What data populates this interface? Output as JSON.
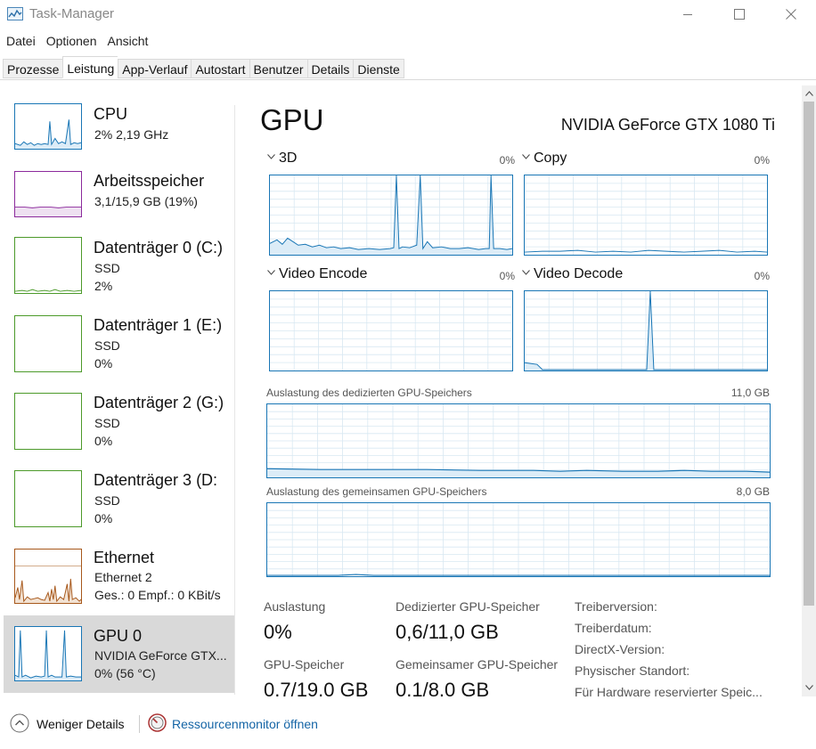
{
  "window": {
    "title": "Task-Manager"
  },
  "menu": [
    "Datei",
    "Optionen",
    "Ansicht"
  ],
  "tabs": [
    {
      "label": "Prozesse",
      "active": false
    },
    {
      "label": "Leistung",
      "active": true
    },
    {
      "label": "App-Verlauf",
      "active": false
    },
    {
      "label": "Autostart",
      "active": false
    },
    {
      "label": "Benutzer",
      "active": false
    },
    {
      "label": "Details",
      "active": false
    },
    {
      "label": "Dienste",
      "active": false
    }
  ],
  "sidebar": {
    "items": [
      {
        "name": "CPU",
        "line1": "2% 2,19 GHz",
        "line2": "",
        "color": "#1976b5"
      },
      {
        "name": "Arbeitsspeicher",
        "line1": "3,1/15,9 GB (19%)",
        "line2": "",
        "color": "#8b2a9c"
      },
      {
        "name": "Datenträger 0 (C:)",
        "line1": "SSD",
        "line2": "2%",
        "color": "#4c9a2a"
      },
      {
        "name": "Datenträger 1 (E:)",
        "line1": "SSD",
        "line2": "0%",
        "color": "#4c9a2a"
      },
      {
        "name": "Datenträger 2 (G:)",
        "line1": "SSD",
        "line2": "0%",
        "color": "#4c9a2a"
      },
      {
        "name": "Datenträger 3 (D:",
        "line1": "SSD",
        "line2": "0%",
        "color": "#4c9a2a"
      },
      {
        "name": "Ethernet",
        "line1": "Ethernet 2",
        "line2": "Ges.: 0 Empf.: 0 KBit/s",
        "color": "#a7581b"
      },
      {
        "name": "GPU 0",
        "line1": "NVIDIA GeForce GTX...",
        "line2": "0% (56 °C)",
        "color": "#1976b5",
        "selected": true
      }
    ]
  },
  "gpu": {
    "heading": "GPU",
    "model": "NVIDIA GeForce GTX 1080 Ti",
    "engines": [
      {
        "label": "3D",
        "value": "0%"
      },
      {
        "label": "Copy",
        "value": "0%"
      },
      {
        "label": "Video Encode",
        "value": "0%"
      },
      {
        "label": "Video Decode",
        "value": "0%"
      }
    ],
    "dedicated_memory": {
      "label": "Auslastung des dedizierten GPU-Speichers",
      "max": "11,0 GB"
    },
    "shared_memory": {
      "label": "Auslastung des gemeinsamen GPU-Speichers",
      "max": "8,0 GB"
    },
    "stats": [
      {
        "label": "Auslastung",
        "value": "0%"
      },
      {
        "label": "Dedizierter GPU-Speicher",
        "value": "0,6/11,0 GB"
      },
      {
        "label": "GPU-Speicher",
        "value": "0.7/19.0 GB"
      },
      {
        "label": "Gemeinsamer GPU-Speicher",
        "value": "0.1/8.0 GB"
      }
    ],
    "properties": [
      "Treiberversion:",
      "Treiberdatum:",
      "DirectX-Version:",
      "Physischer Standort:",
      "Für Hardware reservierter Speic..."
    ]
  },
  "footer": {
    "fewer_details": "Weniger Details",
    "resource_monitor": "Ressourcenmonitor öffnen"
  },
  "colors": {
    "gpu_line": "#1976b5",
    "grid": "#d8e8f2",
    "selected_bg": "#d9d9d9",
    "link": "#1565a6"
  }
}
